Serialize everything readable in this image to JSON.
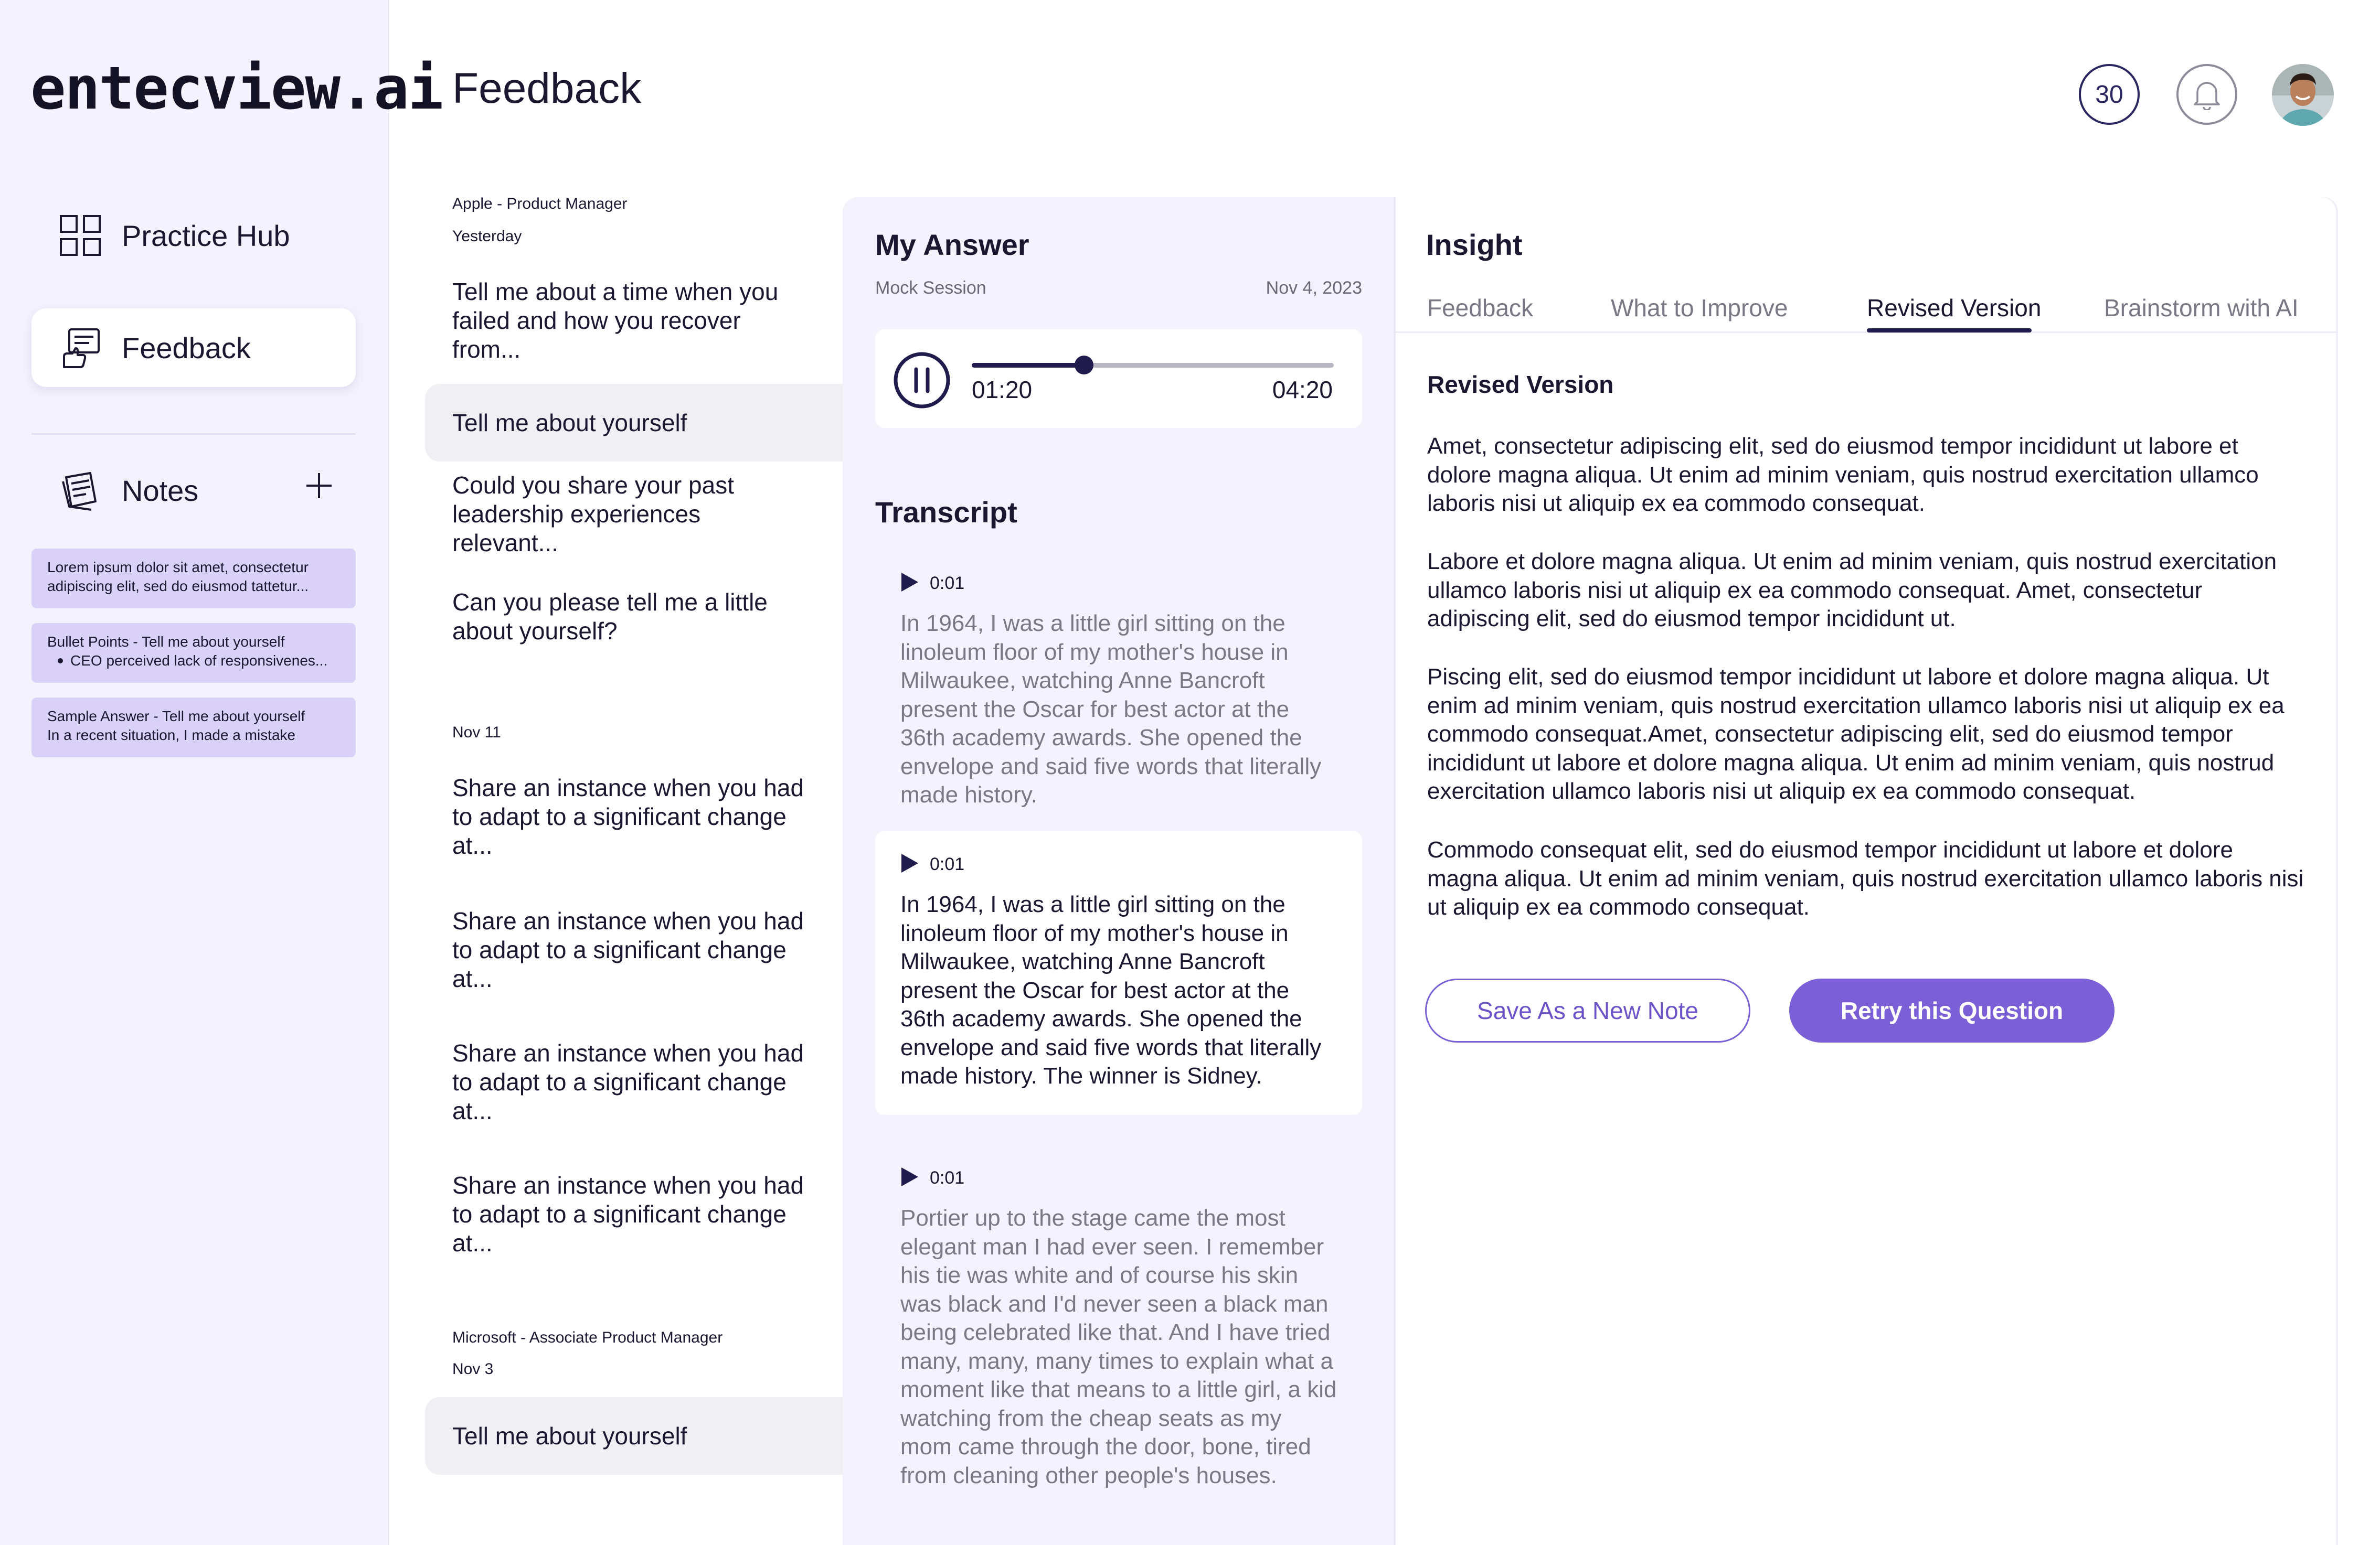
{
  "app": {
    "logo_text": "entecview.ai"
  },
  "sidebar": {
    "nav": [
      {
        "label": "Practice Hub",
        "icon": "grid-icon"
      },
      {
        "label": "Feedback",
        "icon": "feedback-icon"
      }
    ],
    "notes": {
      "label": "Notes",
      "cards": [
        {
          "line1": "Lorem ipsum dolor sit amet, consectetur",
          "line2": "adipiscing elit, sed do eiusmod tattetur..."
        },
        {
          "line1": "Bullet Points - Tell me about yourself",
          "line2": "CEO perceived lack of responsivenes..."
        },
        {
          "line1": "Sample Answer - Tell me about yourself",
          "line2": "In a recent situation, I made a mistake"
        }
      ]
    }
  },
  "header": {
    "title": "Feedback",
    "credits": "30"
  },
  "questions": {
    "groups": [
      {
        "title": "Apple - Product Manager",
        "date": "Yesterday",
        "items": [
          "Tell me about a time when you failed and how you recover from...",
          "Tell me about yourself",
          "Could you share your past leadership experiences relevant...",
          "Can you please tell me a little about yourself?"
        ]
      },
      {
        "date": "Nov 11",
        "items": [
          "Share an instance when you had to adapt to a significant change at...",
          "Share an instance when you had to adapt to a significant change at...",
          "Share an instance when you had to adapt to a significant change at...",
          "Share an instance when you had to adapt to a significant change at..."
        ]
      },
      {
        "title": "Microsoft - Associate Product Manager",
        "date": "Nov 3",
        "items": [
          "Tell me about yourself"
        ]
      }
    ]
  },
  "answer": {
    "title": "My Answer",
    "session": "Mock Session",
    "date": "Nov 4, 2023",
    "player": {
      "current": "01:20",
      "total": "04:20",
      "progress": 0.31
    },
    "transcript_title": "Transcript",
    "segments": [
      {
        "time": "0:01",
        "text": "In 1964, I was a little girl sitting on the linoleum floor of my mother's house in Milwaukee, watching Anne Bancroft present the Oscar for best actor at the 36th academy awards. She opened the envelope and said five words that literally made history."
      },
      {
        "time": "0:01",
        "text": "In 1964, I was a little girl sitting on the linoleum floor of my mother's house in Milwaukee, watching Anne Bancroft present the Oscar for best actor at the 36th academy awards. She opened the envelope and said five words that literally made history. The winner is Sidney."
      },
      {
        "time": "0:01",
        "text": "Portier up to the stage came the most elegant man I had ever seen. I remember his tie was white and of course his skin was black and I'd never seen a black man being celebrated like that. And I have tried many, many, many times to explain what a moment like that means to a little girl, a kid watching from the cheap seats as my mom came through the door, bone, tired from cleaning other people's houses."
      }
    ]
  },
  "insight": {
    "title": "Insight",
    "tabs": [
      "Feedback",
      "What to Improve",
      "Revised Version",
      "Brainstorm with AI"
    ],
    "active_tab": "Revised Version",
    "section_title": "Revised Version",
    "paragraphs": [
      "Amet, consectetur adipiscing elit, sed do eiusmod tempor incididunt ut labore et dolore magna aliqua. Ut enim ad minim veniam, quis nostrud exercitation ullamco laboris nisi ut aliquip ex ea commodo consequat.",
      "Labore et dolore magna aliqua. Ut enim ad minim veniam, quis nostrud exercitation ullamco laboris nisi ut aliquip ex ea commodo consequat. Amet, consectetur adipiscing elit, sed do eiusmod tempor incididunt ut.",
      "Piscing elit, sed do eiusmod tempor incididunt ut labore et dolore magna aliqua. Ut enim ad minim veniam, quis nostrud exercitation ullamco laboris nisi ut aliquip ex ea commodo consequat.Amet, consectetur adipiscing elit, sed do eiusmod tempor incididunt ut labore et dolore magna aliqua. Ut enim ad minim veniam, quis nostrud exercitation ullamco laboris nisi ut aliquip ex ea commodo consequat.",
      "Commodo consequat elit, sed do eiusmod tempor incididunt ut labore et dolore magna aliqua. Ut enim ad minim veniam, quis nostrud exercitation ullamco laboris nisi ut aliquip ex ea commodo consequat."
    ],
    "buttons": {
      "save": "Save As a New Note",
      "retry": "Retry this Question"
    }
  },
  "colors": {
    "accent": "#7b5fd6",
    "navy": "#1f1b4d",
    "sidebar_bg": "#f4f2fd",
    "note_bg": "#d9d1f8"
  }
}
